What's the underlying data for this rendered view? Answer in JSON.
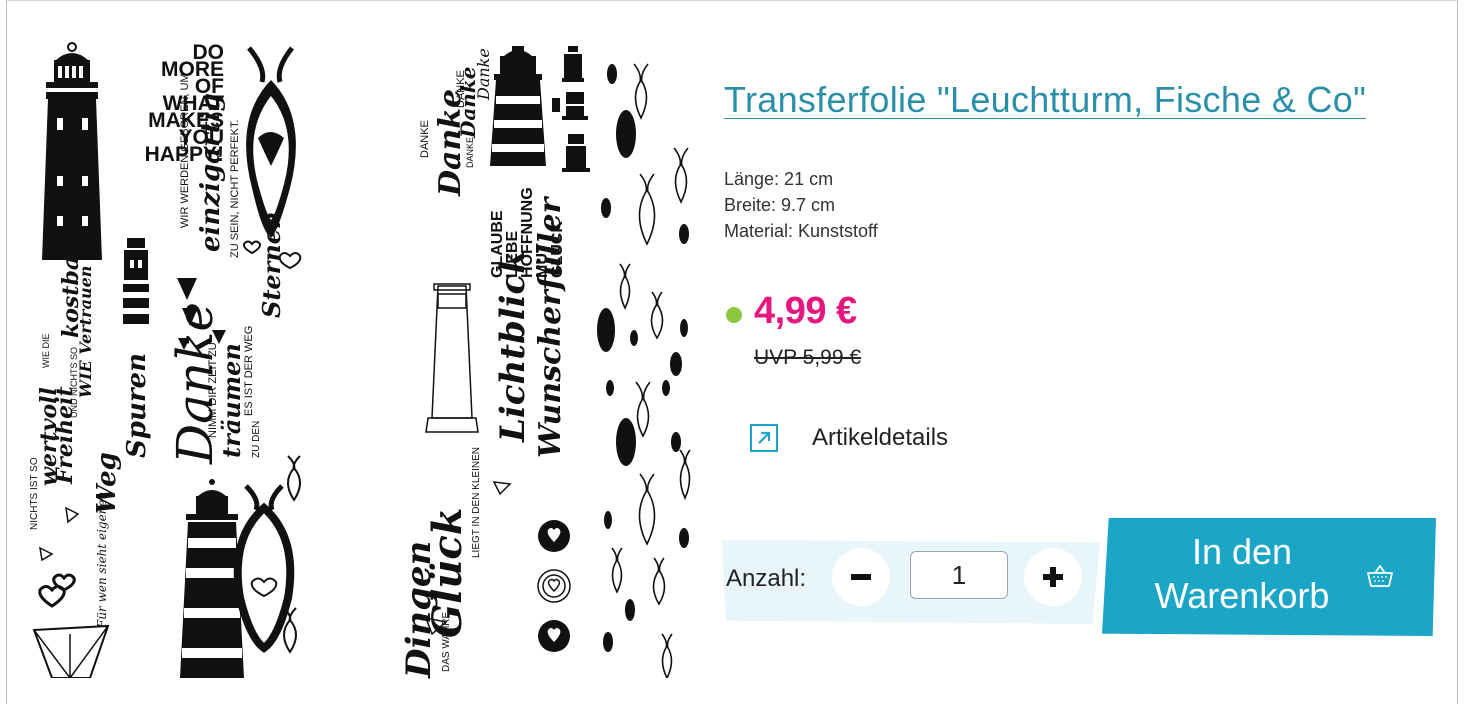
{
  "product": {
    "title": "Transferfolie \"Leuchtturm, Fische & Co\"",
    "specs": [
      "Länge: 21 cm",
      "Breite: 9.7 cm",
      "Material: Kunststoff"
    ],
    "price": "4,99 €",
    "uvp": "UVP 5,99 €",
    "details_label": "Artikeldetails",
    "quantity_label": "Anzahl:",
    "quantity_value": "1",
    "cart_button_label": "In den Warenkorb"
  },
  "sheet1": {
    "motto": [
      "DO",
      "MORE",
      "OF",
      "WHAT",
      "MAKES",
      "YOU",
      "HAPPY!"
    ],
    "lines": [
      "WIR WERDEN GEBOREN, UM",
      "einzigartig",
      "ZU SEIN, NICHT PERFEKT.",
      "Danke",
      "Spuren",
      "Weg",
      "NIMM DIR ZEIT ZU",
      "träumen",
      "ES IST DER WEG",
      "ZU DEN",
      "Sternen",
      "NICHTS IST SO",
      "wertvoll",
      "WIE DIE",
      "Freiheit",
      "UND NICHTS SO",
      "kostbar",
      "WIE Vertrauen",
      "Für wen sieht eigenen"
    ]
  },
  "sheet2": {
    "lines": [
      "DANKE",
      "Danke",
      "DANKE",
      "Danke",
      "DANKE",
      "Danke",
      "GLAUBE",
      "LIEBE",
      "HOFFNUNG",
      "MUT",
      "GLÜCK",
      "Lichtblick",
      "Wunscherfüller",
      "DAS WAHRE",
      "Glück",
      "LIEGT IN DEN KLEINEN",
      "Dingen"
    ]
  },
  "colors": {
    "title": "#2b8fa8",
    "price": "#e5177e",
    "availability": "#8cc63f",
    "accent": "#1ba5c6",
    "quantity_bg": "#e8f5fa"
  },
  "icons": {
    "details": "external-link-icon",
    "minus": "minus-icon",
    "plus": "plus-icon",
    "cart": "basket-icon"
  }
}
